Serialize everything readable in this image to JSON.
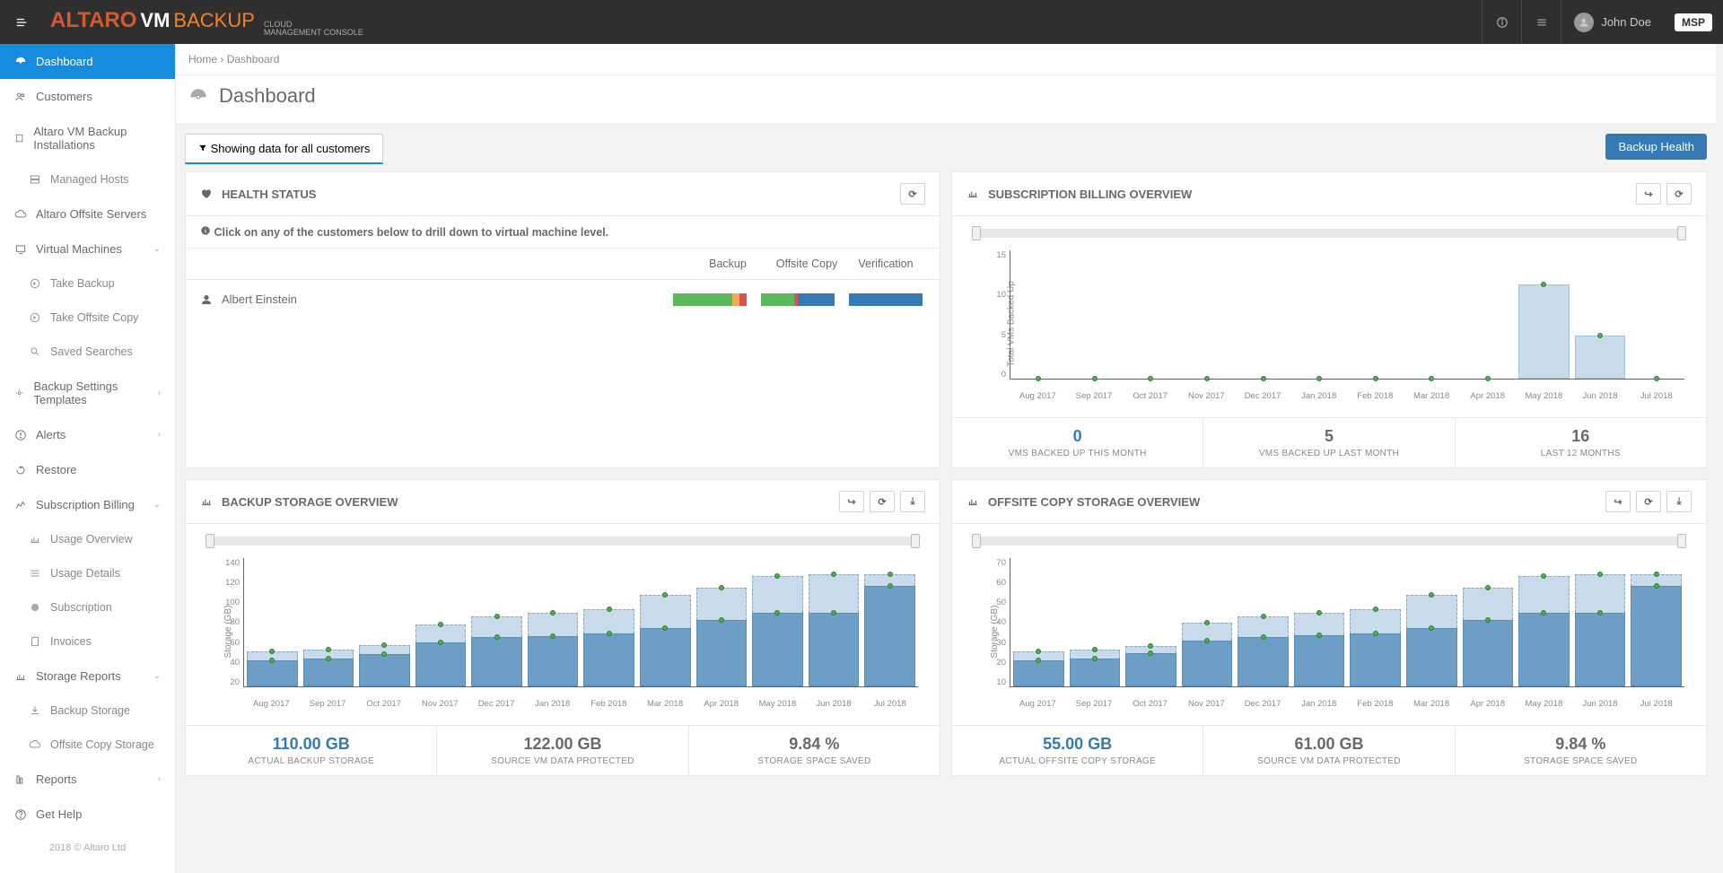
{
  "header": {
    "logo_main": "ALTARO",
    "logo_vm": "VM",
    "logo_backup": "BACKUP",
    "logo_sub1": "CLOUD",
    "logo_sub2": "MANAGEMENT CONSOLE",
    "user_name": "John Doe",
    "msp_badge": "MSP"
  },
  "breadcrumb": {
    "home": "Home",
    "current": "Dashboard"
  },
  "page_title": "Dashboard",
  "filter_label": "Showing data for all customers",
  "backup_health_btn": "Backup Health",
  "sidebar": {
    "items": [
      {
        "label": "Dashboard"
      },
      {
        "label": "Customers"
      },
      {
        "label": "Altaro VM Backup Installations"
      },
      {
        "label": "Managed Hosts"
      },
      {
        "label": "Altaro Offsite Servers"
      },
      {
        "label": "Virtual Machines"
      },
      {
        "label": "Take Backup"
      },
      {
        "label": "Take Offsite Copy"
      },
      {
        "label": "Saved Searches"
      },
      {
        "label": "Backup Settings Templates"
      },
      {
        "label": "Alerts"
      },
      {
        "label": "Restore"
      },
      {
        "label": "Subscription Billing"
      },
      {
        "label": "Usage Overview"
      },
      {
        "label": "Usage Details"
      },
      {
        "label": "Subscription"
      },
      {
        "label": "Invoices"
      },
      {
        "label": "Storage Reports"
      },
      {
        "label": "Backup Storage"
      },
      {
        "label": "Offsite Copy Storage"
      },
      {
        "label": "Reports"
      },
      {
        "label": "Get Help"
      }
    ],
    "copyright": "2018 © Altaro Ltd"
  },
  "health": {
    "title": "HEALTH STATUS",
    "drill_hint": "Click on any of the customers below to drill down to virtual machine level.",
    "cols": {
      "backup": "Backup",
      "offsite": "Offsite Copy",
      "verify": "Verification"
    },
    "rows": [
      {
        "name": "Albert Einstein"
      }
    ]
  },
  "subscription": {
    "title": "SUBSCRIPTION BILLING OVERVIEW",
    "stats": [
      {
        "num": "0",
        "label": "VMS BACKED UP THIS MONTH",
        "blue": true
      },
      {
        "num": "5",
        "label": "VMS BACKED UP LAST MONTH"
      },
      {
        "num": "16",
        "label": "LAST 12 MONTHS"
      }
    ]
  },
  "backup_storage": {
    "title": "BACKUP STORAGE OVERVIEW",
    "stats": [
      {
        "num": "110.00 GB",
        "label": "ACTUAL BACKUP STORAGE",
        "blue": true
      },
      {
        "num": "122.00 GB",
        "label": "SOURCE VM DATA PROTECTED"
      },
      {
        "num": "9.84 %",
        "label": "STORAGE SPACE SAVED"
      }
    ]
  },
  "offsite_storage": {
    "title": "OFFSITE COPY STORAGE OVERVIEW",
    "stats": [
      {
        "num": "55.00 GB",
        "label": "ACTUAL OFFSITE COPY STORAGE",
        "blue": true
      },
      {
        "num": "61.00 GB",
        "label": "SOURCE VM DATA PROTECTED"
      },
      {
        "num": "9.84 %",
        "label": "STORAGE SPACE SAVED"
      }
    ]
  },
  "chart_data": [
    {
      "id": "subscription",
      "type": "bar",
      "ylabel": "Total VMs Backed Up",
      "ylim": [
        0,
        15
      ],
      "yticks": [
        0,
        5,
        10,
        15
      ],
      "categories": [
        "Aug 2017",
        "Sep 2017",
        "Oct 2017",
        "Nov 2017",
        "Dec 2017",
        "Jan 2018",
        "Feb 2018",
        "Mar 2018",
        "Apr 2018",
        "May 2018",
        "Jun 2018",
        "Jul 2018"
      ],
      "values": [
        0,
        0,
        0,
        0,
        0,
        0,
        0,
        0,
        0,
        11,
        5,
        0
      ]
    },
    {
      "id": "backup_storage",
      "type": "bar",
      "ylabel": "Storage (GB)",
      "ylim": [
        0,
        140
      ],
      "yticks": [
        20,
        40,
        60,
        80,
        100,
        120,
        140
      ],
      "categories": [
        "Aug 2017",
        "Sep 2017",
        "Oct 2017",
        "Nov 2017",
        "Dec 2017",
        "Jan 2018",
        "Feb 2018",
        "Mar 2018",
        "Apr 2018",
        "May 2018",
        "Jun 2018",
        "Jul 2018"
      ],
      "series": [
        {
          "name": "actual",
          "values": [
            28,
            30,
            35,
            48,
            54,
            55,
            58,
            64,
            72,
            80,
            80,
            110
          ]
        },
        {
          "name": "source",
          "values": [
            38,
            40,
            45,
            68,
            76,
            80,
            84,
            100,
            108,
            120,
            122,
            122
          ]
        }
      ]
    },
    {
      "id": "offsite_storage",
      "type": "bar",
      "ylabel": "Storage (GB)",
      "ylim": [
        0,
        70
      ],
      "yticks": [
        10,
        20,
        30,
        40,
        50,
        60,
        70
      ],
      "categories": [
        "Aug 2017",
        "Sep 2017",
        "Oct 2017",
        "Nov 2017",
        "Dec 2017",
        "Jan 2018",
        "Feb 2018",
        "Mar 2018",
        "Apr 2018",
        "May 2018",
        "Jun 2018",
        "Jul 2018"
      ],
      "series": [
        {
          "name": "actual",
          "values": [
            14,
            15,
            18,
            25,
            27,
            28,
            29,
            32,
            36,
            40,
            40,
            55
          ]
        },
        {
          "name": "source",
          "values": [
            19,
            20,
            22,
            35,
            38,
            40,
            42,
            50,
            54,
            60,
            61,
            61
          ]
        }
      ]
    }
  ]
}
